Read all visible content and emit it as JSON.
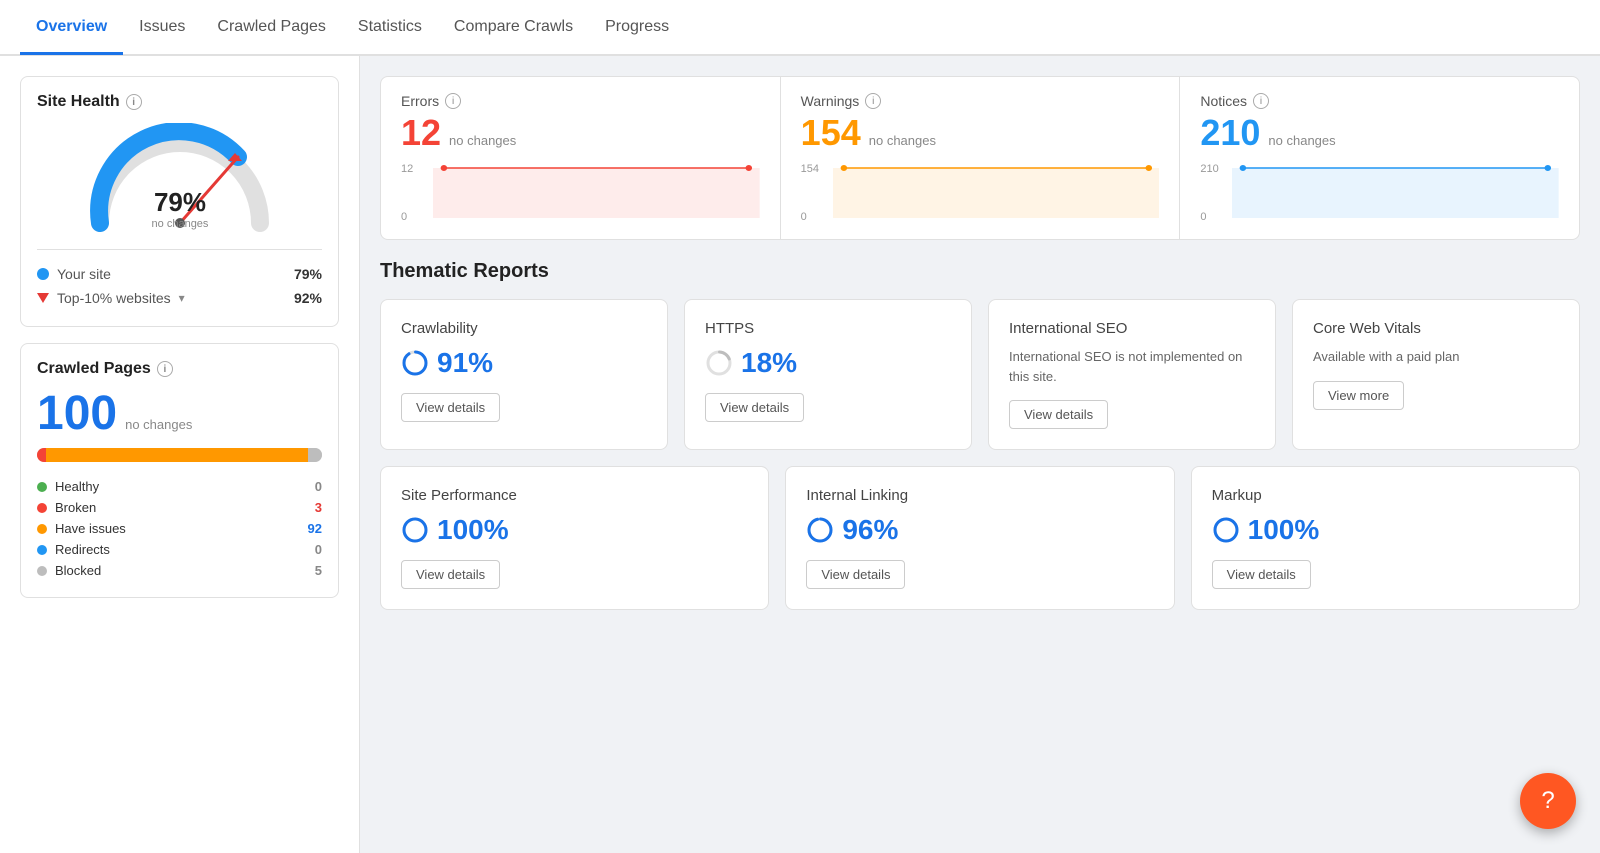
{
  "nav": {
    "items": [
      {
        "label": "Overview",
        "active": true
      },
      {
        "label": "Issues",
        "active": false
      },
      {
        "label": "Crawled Pages",
        "active": false
      },
      {
        "label": "Statistics",
        "active": false
      },
      {
        "label": "Compare Crawls",
        "active": false
      },
      {
        "label": "Progress",
        "active": false
      }
    ]
  },
  "siteHealth": {
    "title": "Site Health",
    "percent": "79%",
    "subtext": "no changes",
    "yourSiteLabel": "Your site",
    "yourSiteValue": "79%",
    "topSitesLabel": "Top-10% websites",
    "topSitesValue": "92%"
  },
  "crawledPages": {
    "title": "Crawled Pages",
    "count": "100",
    "noChanges": "no changes",
    "legend": [
      {
        "label": "Healthy",
        "value": "0",
        "color": "#4caf50",
        "valueClass": "gray"
      },
      {
        "label": "Broken",
        "value": "3",
        "color": "#f44336",
        "valueClass": "red"
      },
      {
        "label": "Have issues",
        "value": "92",
        "color": "#ff9800",
        "valueClass": "blue"
      },
      {
        "label": "Redirects",
        "value": "0",
        "color": "#2196f3",
        "valueClass": "gray"
      },
      {
        "label": "Blocked",
        "value": "5",
        "color": "#bdbdbd",
        "valueClass": "gray"
      }
    ]
  },
  "metrics": [
    {
      "label": "Errors",
      "value": "12",
      "valueClass": "red",
      "noChanges": "no changes",
      "chartMax": "12",
      "chartMin": "0",
      "chartColor": "#f44336",
      "chartBg": "rgba(244,67,54,0.1)"
    },
    {
      "label": "Warnings",
      "value": "154",
      "valueClass": "orange",
      "noChanges": "no changes",
      "chartMax": "154",
      "chartMin": "0",
      "chartColor": "#ff9800",
      "chartBg": "rgba(255,152,0,0.1)"
    },
    {
      "label": "Notices",
      "value": "210",
      "valueClass": "blue",
      "noChanges": "no changes",
      "chartMax": "210",
      "chartMin": "0",
      "chartColor": "#2196f3",
      "chartBg": "rgba(33,150,243,0.1)"
    }
  ],
  "thematicReports": {
    "title": "Thematic Reports",
    "topCards": [
      {
        "title": "Crawlability",
        "percent": "91%",
        "hasCircle": true,
        "circleColor": "#1a73e8",
        "btnLabel": "View details"
      },
      {
        "title": "HTTPS",
        "percent": "18%",
        "hasCircle": true,
        "circleColor": "#bdbdbd",
        "btnLabel": "View details"
      },
      {
        "title": "International SEO",
        "percent": null,
        "description": "International SEO is not implemented on this site.",
        "hasCircle": false,
        "btnLabel": "View details"
      },
      {
        "title": "Core Web Vitals",
        "percent": null,
        "description": "Available with a paid plan",
        "hasCircle": false,
        "btnLabel": "View more"
      }
    ],
    "bottomCards": [
      {
        "title": "Site Performance",
        "percent": "100%",
        "hasCircle": true,
        "circleColor": "#1a73e8",
        "btnLabel": "View details"
      },
      {
        "title": "Internal Linking",
        "percent": "96%",
        "hasCircle": true,
        "circleColor": "#1a73e8",
        "btnLabel": "View details"
      },
      {
        "title": "Markup",
        "percent": "100%",
        "hasCircle": true,
        "circleColor": "#1a73e8",
        "btnLabel": "View details"
      }
    ]
  }
}
